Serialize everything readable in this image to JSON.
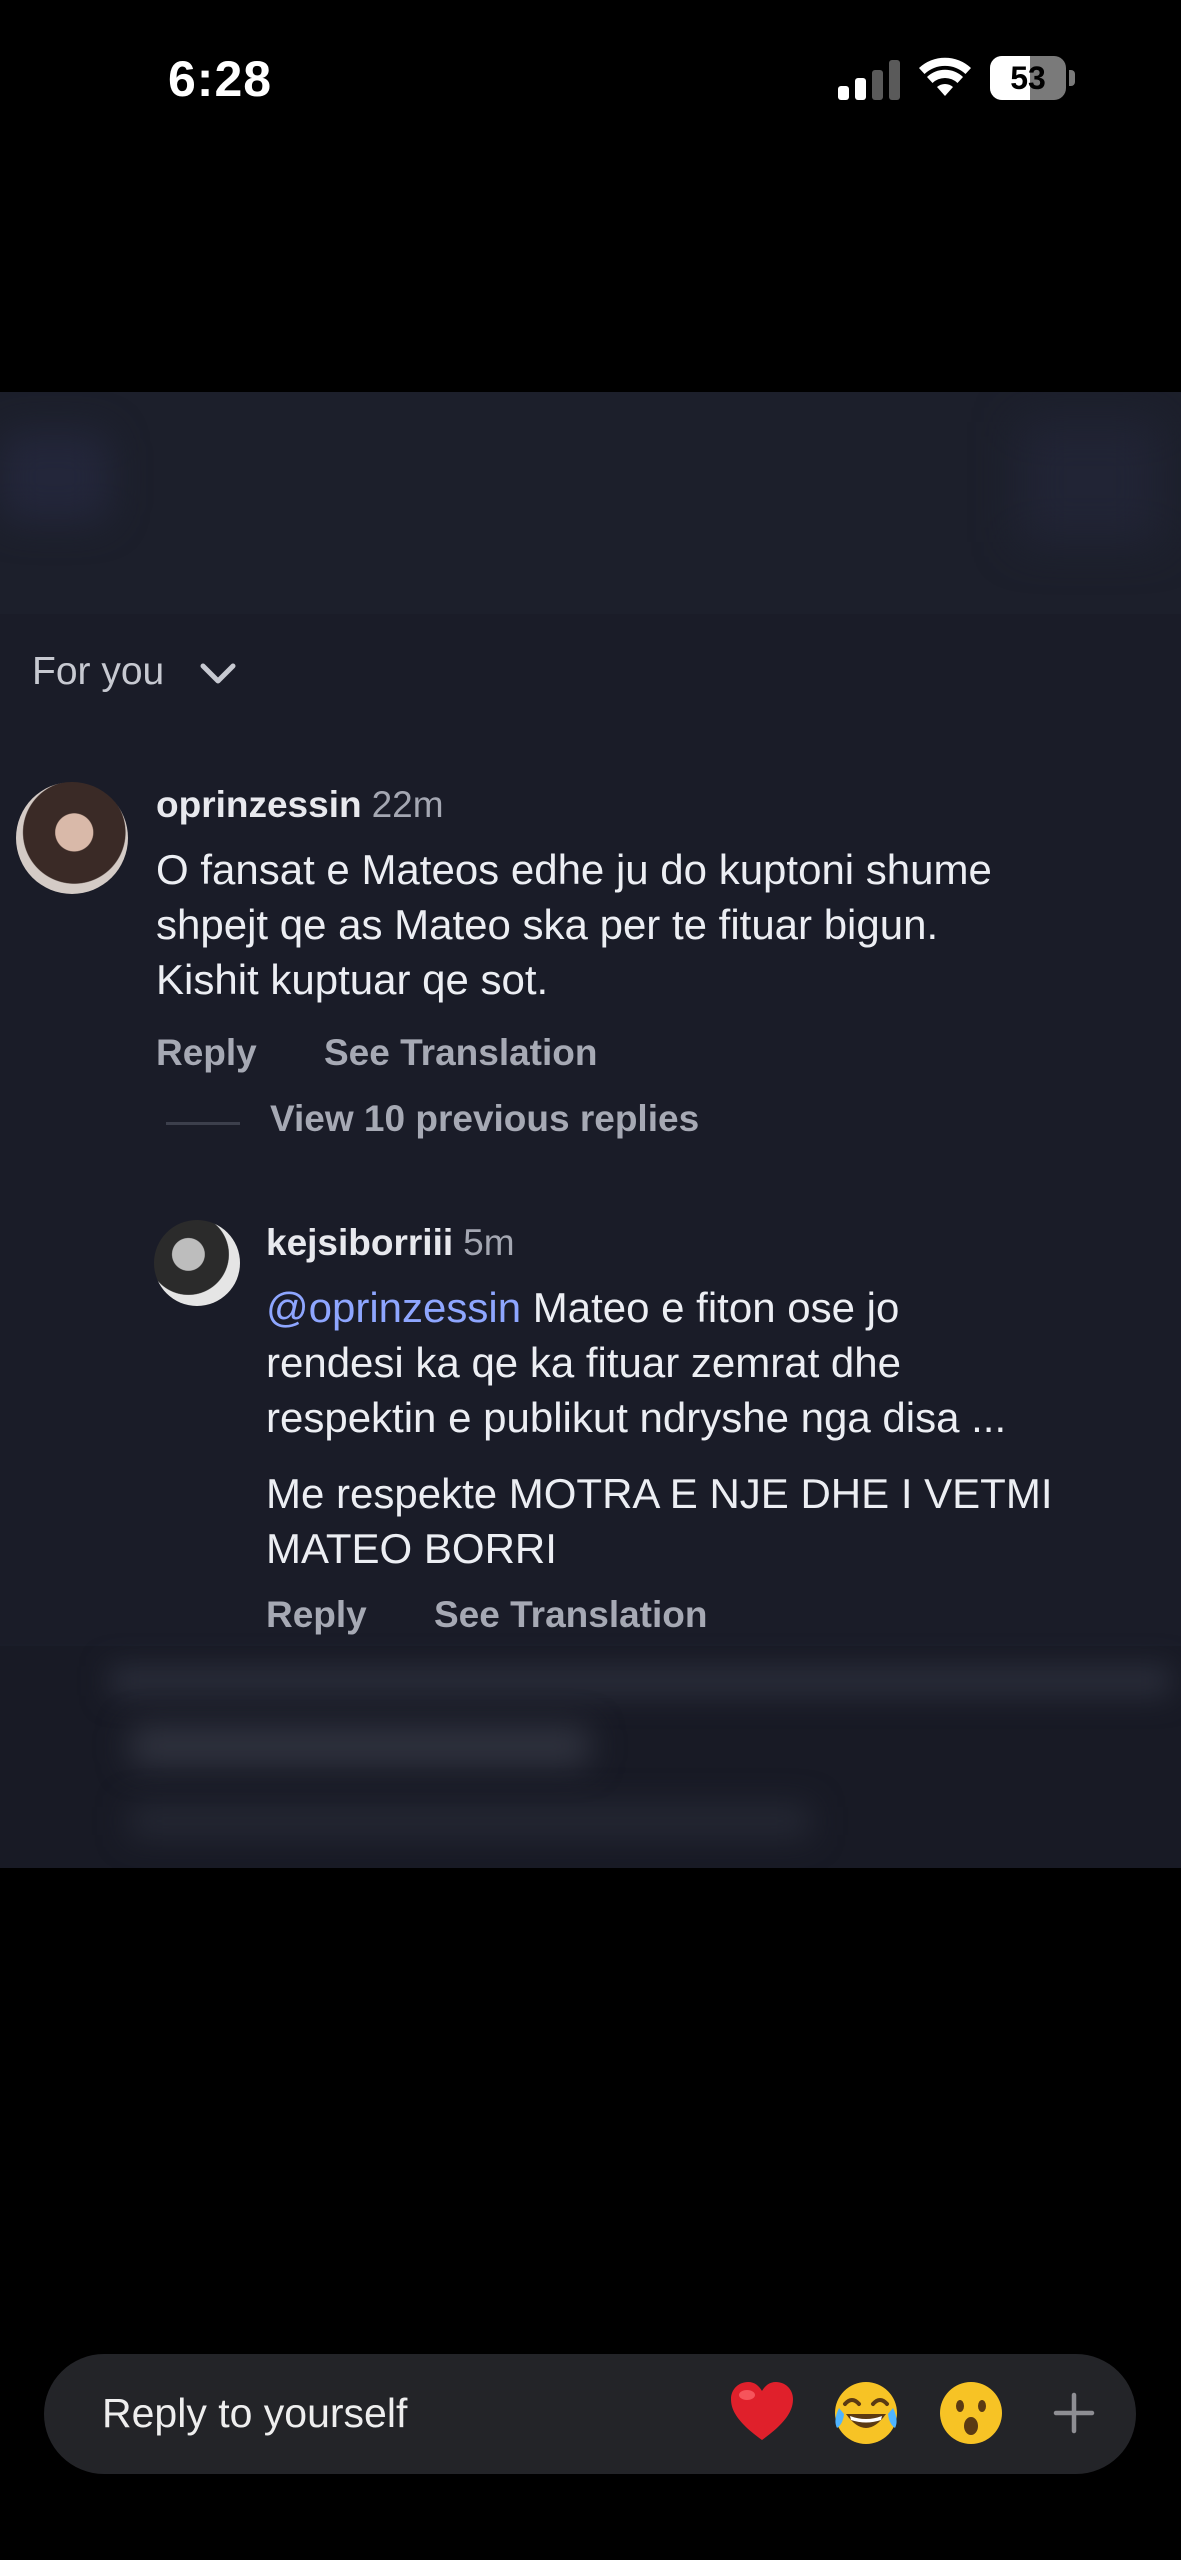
{
  "status_bar": {
    "time": "6:28",
    "battery": "53",
    "battery_level": 0.53
  },
  "feed": {
    "sort_label": "For you"
  },
  "comments": [
    {
      "username": "oprinzessin",
      "time": "22m",
      "text": "O fansat e Mateos edhe ju do kuptoni shume\nshpejt qe as Mateo ska per te fituar bigun.\nKishit kuptuar qe sot.",
      "reply_label": "Reply",
      "translate_label": "See Translation",
      "view_replies_label": "View 10 previous replies"
    },
    {
      "username": "kejsiborriii",
      "time": "5m",
      "mention": "@oprinzessin",
      "text_after_mention": " Mateo e fiton ose jo\nrendesi ka qe ka fituar zemrat dhe\nrespektin e publikut ndryshe nga disa ...",
      "text_line2": "Me respekte MOTRA E NJE DHE I VETMI\nMATEO BORRI",
      "reply_label": "Reply",
      "translate_label": "See Translation"
    }
  ],
  "reply_bar": {
    "placeholder": "Reply to yourself",
    "icons": [
      "heart-emoji",
      "laughing-emoji",
      "surprised-emoji",
      "plus-icon"
    ]
  }
}
